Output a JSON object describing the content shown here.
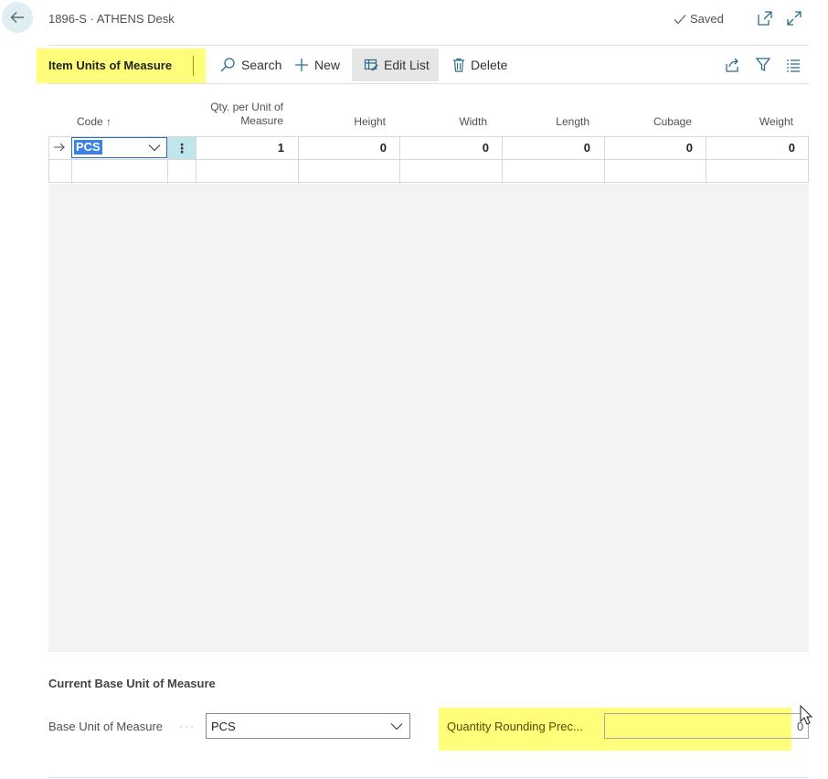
{
  "header": {
    "title": "1896-S · ATHENS Desk",
    "status": "Saved"
  },
  "actionbar": {
    "page_label": "Item Units of Measure",
    "search_label": "Search",
    "new_label": "New",
    "edit_list_label": "Edit List",
    "delete_label": "Delete"
  },
  "grid": {
    "columns": {
      "code": "Code",
      "qty_line1": "Qty. per Unit of",
      "qty_line2": "Measure",
      "height": "Height",
      "width": "Width",
      "length": "Length",
      "cubage": "Cubage",
      "weight": "Weight"
    },
    "rows": [
      {
        "code": "PCS",
        "qty": "1",
        "height": "0",
        "width": "0",
        "length": "0",
        "cubage": "0",
        "weight": "0"
      }
    ]
  },
  "fasttab": {
    "title": "Current Base Unit of Measure",
    "base_uom_label": "Base Unit of Measure",
    "base_uom_value": "PCS",
    "qty_rounding_label": "Quantity Rounding Prec...",
    "qty_rounding_value": "0"
  },
  "colors": {
    "highlight": "#fefe7a",
    "accent": "#2a6fb6",
    "selection": "#3b82e6",
    "row_action": "#bfe6ea"
  }
}
